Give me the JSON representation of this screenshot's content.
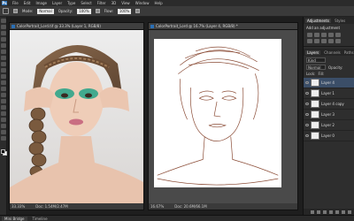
{
  "menubar": {
    "app_icon": "Ps",
    "items": [
      "File",
      "Edit",
      "Image",
      "Layer",
      "Type",
      "Select",
      "Filter",
      "3D",
      "View",
      "Window",
      "Help"
    ]
  },
  "optionsbar": {
    "mode_label": "Mode:",
    "mode_value": "Normal",
    "opacity_label": "Opacity:",
    "opacity_value": "100%",
    "flow_label": "Flow:",
    "flow_value": "100%"
  },
  "left_doc": {
    "title": "ColorPortrait_Lord.tif @ 33.3% (Layer 1, RGB/8)",
    "zoom": "33.33%",
    "doc_size": "Doc: 1.54M/2.47M"
  },
  "right_doc": {
    "title": "ColorPortrait_Lord @ 16.7% (Layer 4, RGB/8) *",
    "zoom": "16.67%",
    "doc_size": "Doc: 20.6M/66.1M"
  },
  "panels": {
    "top_tabs": [
      "Adjustments",
      "Styles"
    ],
    "adjust_title": "Add an adjustment",
    "layer_tabs": [
      "Layers",
      "Channels",
      "Paths"
    ],
    "kind_label": "Kind",
    "blend_mode": "Normal",
    "opacity_label": "Opacity:",
    "lock_label": "Lock:",
    "fill_label": "Fill:",
    "layers": [
      {
        "name": "Layer 4",
        "selected": true
      },
      {
        "name": "Layer 1",
        "selected": false
      },
      {
        "name": "Layer 4 copy",
        "selected": false
      },
      {
        "name": "Layer 3",
        "selected": false
      },
      {
        "name": "Layer 2",
        "selected": false
      },
      {
        "name": "Layer 0",
        "selected": false
      }
    ]
  },
  "bottombar": {
    "tabs": [
      "Mini Bridge",
      "Timeline"
    ]
  }
}
